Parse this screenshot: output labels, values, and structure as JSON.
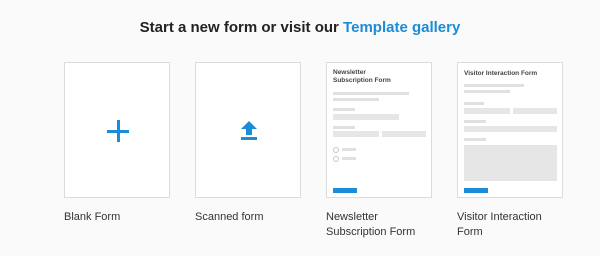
{
  "header": {
    "prefix": "Start a new form or visit our ",
    "link": "Template gallery"
  },
  "cards": [
    {
      "label": "Blank Form",
      "icon": "plus-icon"
    },
    {
      "label": "Scanned form",
      "icon": "upload-icon"
    },
    {
      "label_line1": "Newsletter",
      "label_line2": "Subscription Form",
      "preview_title_line1": "Newsletter",
      "preview_title_line2": "Subscription Form"
    },
    {
      "label_line1": "Visitor Interaction",
      "label_line2": "Form",
      "preview_title": "Visitor Interaction Form"
    }
  ],
  "colors": {
    "accent": "#1a8cd8"
  }
}
